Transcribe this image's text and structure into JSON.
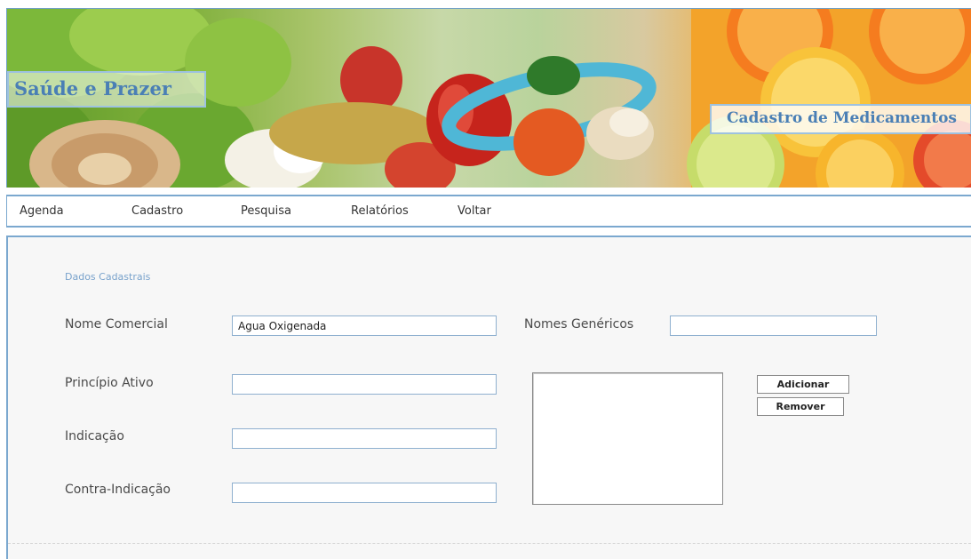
{
  "banner": {
    "brand": "Saúde e Prazer",
    "section_title": "Cadastro de Medicamentos"
  },
  "menu": {
    "items": [
      {
        "label": "Agenda"
      },
      {
        "label": "Cadastro"
      },
      {
        "label": "Pesquisa"
      },
      {
        "label": "Relatórios"
      },
      {
        "label": "Voltar"
      }
    ]
  },
  "form": {
    "legend": "Dados Cadastrais",
    "nome_comercial": {
      "label": "Nome Comercial",
      "value": "Agua Oxigenada"
    },
    "nomes_genericos": {
      "label": "Nomes Genéricos",
      "value": ""
    },
    "principio_ativo": {
      "label": "Princípio Ativo",
      "value": ""
    },
    "indicacao": {
      "label": "Indicação",
      "value": ""
    },
    "contra_indicacao": {
      "label": "Contra-Indicação",
      "value": ""
    },
    "generic_names_list": [],
    "add_button": "Adicionar",
    "remove_button": "Remover"
  },
  "colors": {
    "accent": "#4a7fb5",
    "border": "#7ba8cf",
    "panel_bg": "#f7f7f7"
  }
}
